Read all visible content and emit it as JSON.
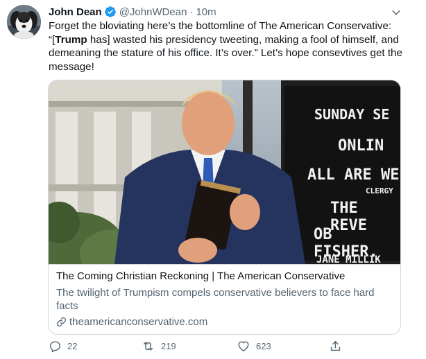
{
  "tweet": {
    "author": {
      "display_name": "John Dean",
      "handle": "@JohnWDean",
      "separator": "·",
      "time": "10m",
      "verified": true,
      "avatar": "dog-avatar"
    },
    "text": {
      "part1": "Forget the bloviating here’s the bottomline of The American Conservative: “[",
      "bold": "Trump",
      "part2": " has] wasted his presidency tweeting, making a fool of himself, and demeaning the stature of his office. It’s over.” Let’s hope consevtives get the message!"
    },
    "card": {
      "image": "trump-holding-bible-photo",
      "sign_lines": [
        "SUNDAY SE",
        "ONLIN",
        "ALL ARE WE",
        "CLERGY",
        "THE REVE",
        "OB FISHER.",
        "JANE MILLIK"
      ],
      "title": "The Coming Christian Reckoning | The American Conservative",
      "description": "The twilight of Trumpism compels conservative believers to face hard facts",
      "domain": "theamericanconservative.com"
    },
    "actions": {
      "reply_count": "22",
      "retweet_count": "219",
      "like_count": "623"
    },
    "colors": {
      "verified": "#1d9bf0",
      "secondary_text": "#536471",
      "border": "#cfd9de"
    },
    "icons": [
      "verified-badge-icon",
      "chevron-down-icon",
      "link-icon",
      "reply-icon",
      "retweet-icon",
      "like-icon",
      "share-icon"
    ]
  }
}
